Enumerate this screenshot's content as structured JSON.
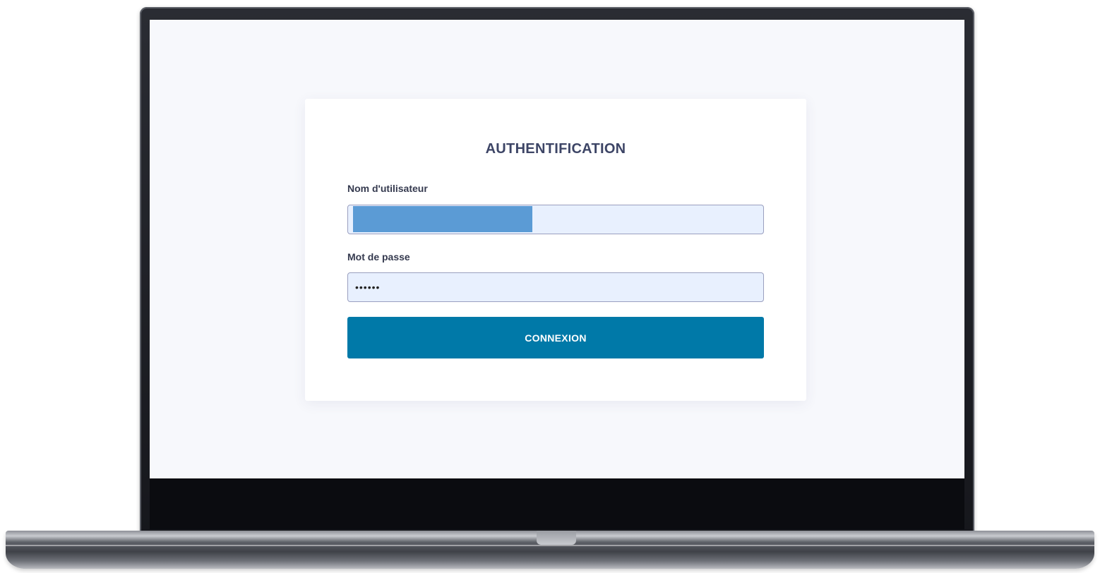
{
  "login": {
    "title": "AUTHENTIFICATION",
    "username_label": "Nom d'utilisateur",
    "username_value": "",
    "password_label": "Mot de passe",
    "password_value": "••••••",
    "submit_label": "CONNEXION"
  },
  "colors": {
    "screen_background": "#f7f8fc",
    "input_background": "#e8f0fe",
    "button_background": "#0079a8",
    "title_text": "#3d4566",
    "redaction": "#5b9bd5"
  }
}
